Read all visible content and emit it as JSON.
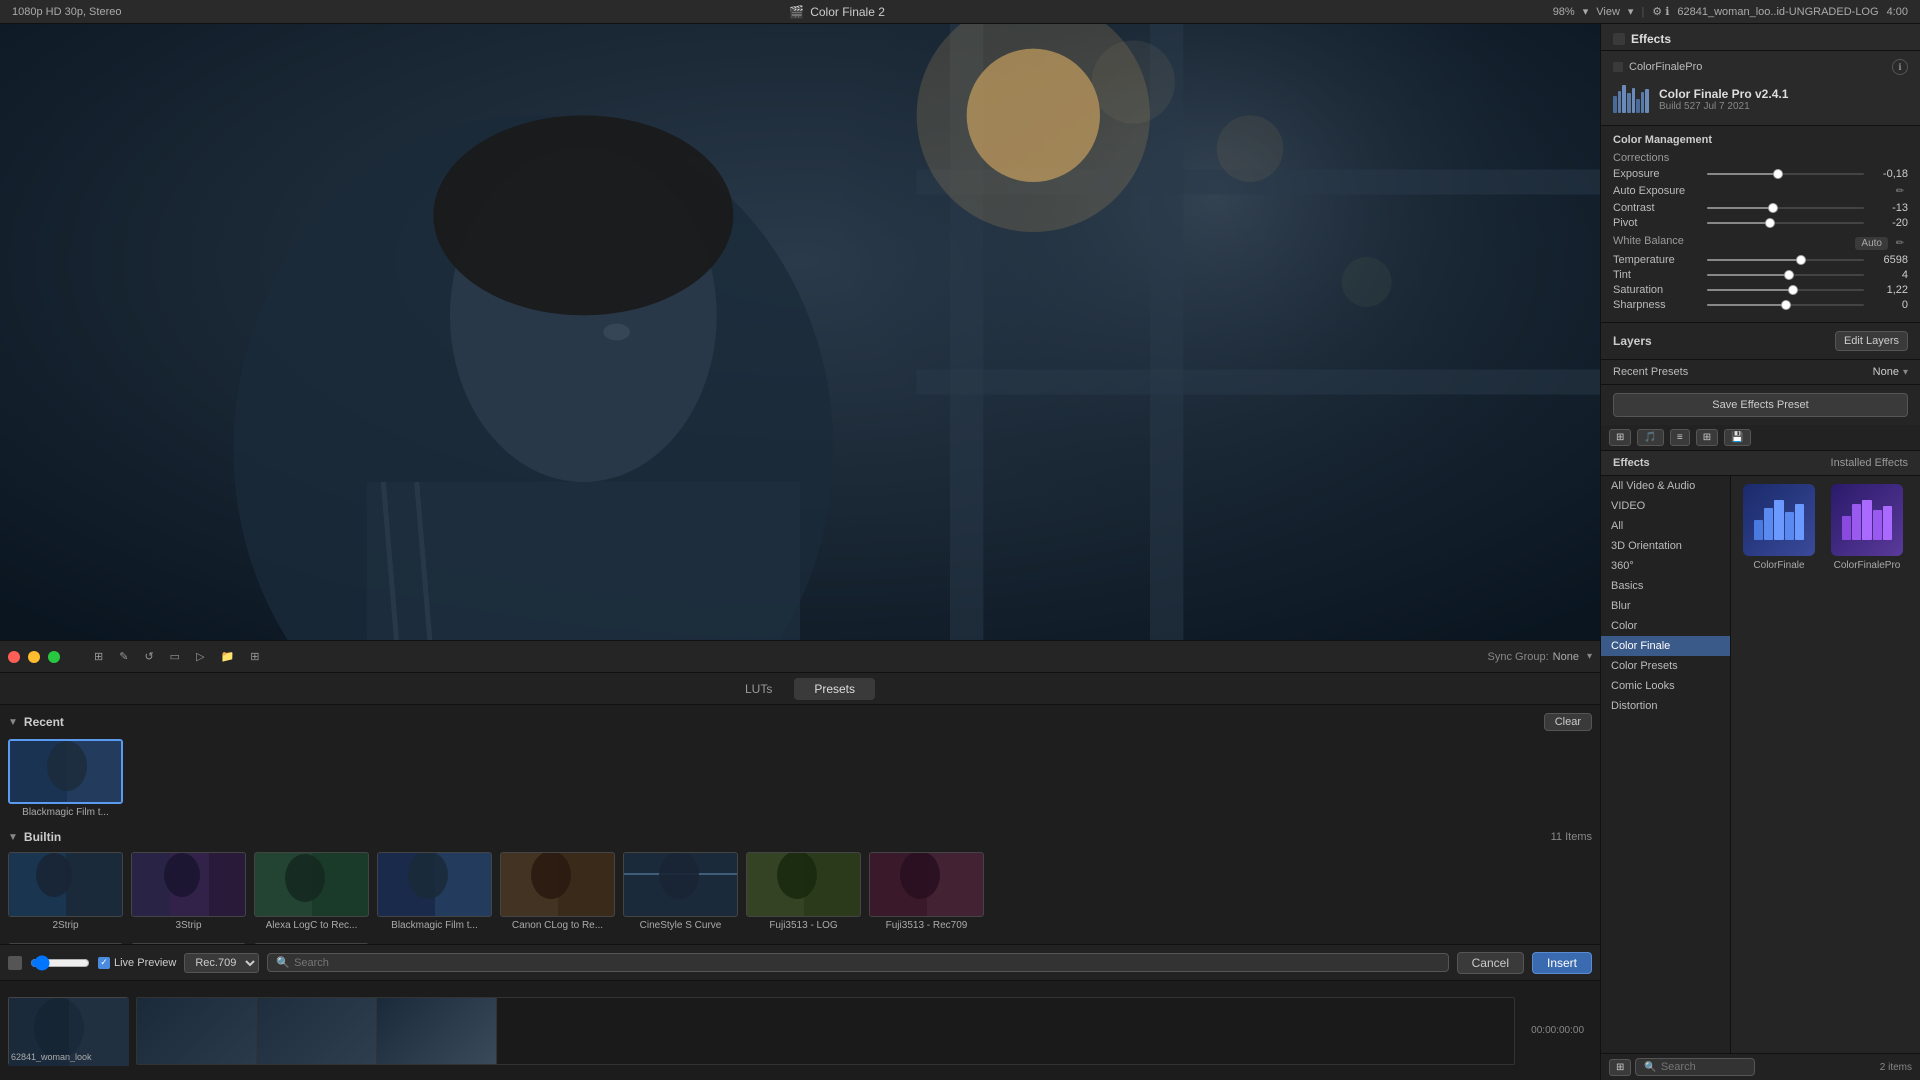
{
  "topbar": {
    "resolution": "1080p HD 30p, Stereo",
    "app_name": "Color Finale 2",
    "zoom": "98%",
    "view": "View",
    "filename": "62841_woman_loo..id-UNGRADED-LOG",
    "timecode": "4:00"
  },
  "browser": {
    "tabs": [
      {
        "id": "luts",
        "label": "LUTs",
        "active": false
      },
      {
        "id": "presets",
        "label": "Presets",
        "active": true
      }
    ],
    "recent_section": {
      "title": "Recent",
      "clear_btn": "Clear",
      "items": [
        {
          "label": "Blackmagic Film t...",
          "selected": true
        }
      ]
    },
    "builtin_section": {
      "title": "Builtin",
      "count": "11 Items",
      "items": [
        {
          "label": "2Strip"
        },
        {
          "label": "3Strip"
        },
        {
          "label": "Alexa LogC to Rec..."
        },
        {
          "label": "Blackmagic Film t..."
        },
        {
          "label": "Canon CLog to Re..."
        },
        {
          "label": "CineStyle S Curve"
        },
        {
          "label": "Fuji3513 - LOG"
        },
        {
          "label": "Fuji3513 - Rec709"
        }
      ],
      "more_items": [
        {
          "label": ""
        },
        {
          "label": ""
        },
        {
          "label": ""
        }
      ]
    },
    "footer": {
      "live_preview": "Live Preview",
      "rec": "Rec.709",
      "search_placeholder": "Search",
      "cancel": "Cancel",
      "insert": "Insert"
    }
  },
  "sync_group": {
    "label": "Sync Group:",
    "value": "None"
  },
  "right_panel": {
    "effects_title": "Effects",
    "cfp_title": "ColorFinalePro",
    "cfp_name": "Color Finale Pro v2.4.1",
    "cfp_build": "Build 527 Jul 7 2021",
    "color_management_title": "Color Management",
    "corrections_title": "Corrections",
    "corrections": {
      "exposure": {
        "label": "Exposure",
        "value": "-0,18",
        "pos": 45
      },
      "auto_exposure": {
        "label": "Auto Exposure"
      },
      "contrast": {
        "label": "Contrast",
        "value": "-13",
        "pos": 42
      },
      "pivot": {
        "label": "Pivot",
        "value": "-20",
        "pos": 40
      },
      "white_balance_title": "White Balance",
      "white_balance_badge": "Auto",
      "temperature": {
        "label": "Temperature",
        "value": "6598",
        "pos": 60
      },
      "tint": {
        "label": "Tint",
        "value": "4",
        "pos": 52
      },
      "saturation": {
        "label": "Saturation",
        "value": "1,22",
        "pos": 55
      },
      "sharpness": {
        "label": "Sharpness",
        "value": "0",
        "pos": 50
      }
    },
    "layers": {
      "label": "Layers",
      "edit_btn": "Edit Layers"
    },
    "recent_presets": {
      "label": "Recent Presets",
      "value": "None"
    },
    "save_preset_btn": "Save Effects Preset",
    "effects_section": {
      "title": "Effects",
      "installed_title": "Installed Effects",
      "sidebar_items": [
        {
          "label": "All Video & Audio",
          "active": false
        },
        {
          "label": "VIDEO",
          "active": false
        },
        {
          "label": "All",
          "active": false
        },
        {
          "label": "3D Orientation",
          "active": false
        },
        {
          "label": "360°",
          "active": false
        },
        {
          "label": "Basics",
          "active": false
        },
        {
          "label": "Blur",
          "active": false
        },
        {
          "label": "Color",
          "active": false
        },
        {
          "label": "Color Finale",
          "active": true
        },
        {
          "label": "Color Presets",
          "active": false
        },
        {
          "label": "Comic Looks",
          "active": false
        },
        {
          "label": "Distortion",
          "active": false
        }
      ],
      "effects": [
        {
          "label": "ColorFinale"
        },
        {
          "label": "ColorFinalePro"
        }
      ],
      "count": "2 items",
      "search_placeholder": "Search"
    }
  },
  "timeline": {
    "clip_label": "62841_woman_look",
    "timecode_start": "00:00:00:00"
  }
}
